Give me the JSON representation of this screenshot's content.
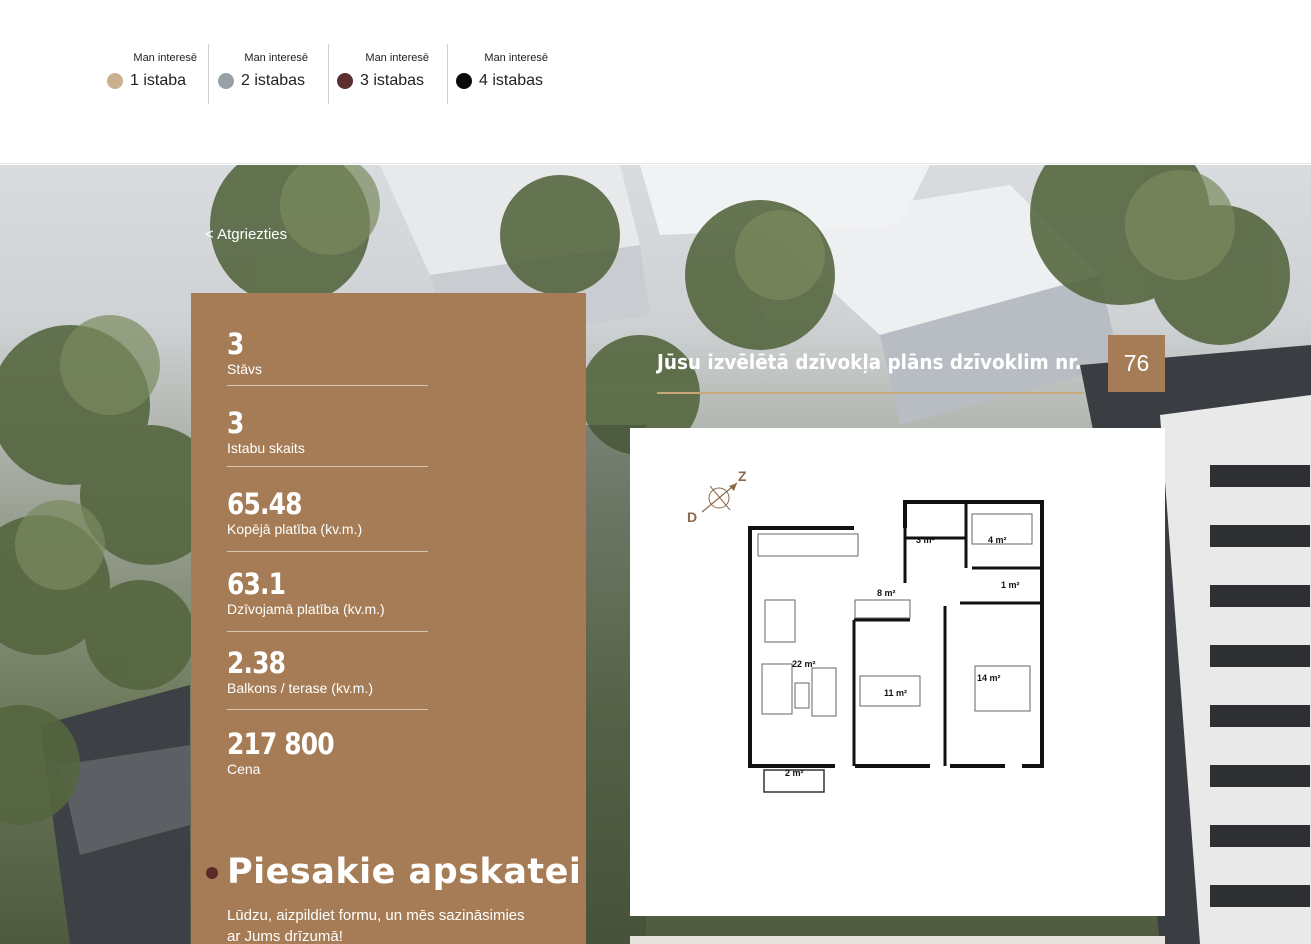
{
  "filters": {
    "caption": "Man interesē",
    "items": [
      {
        "label": "1 istaba",
        "color": "#cbb08f"
      },
      {
        "label": "2 istabas",
        "color": "#97a1a6"
      },
      {
        "label": "3 istabas",
        "color": "#5e2f31"
      },
      {
        "label": "4 istabas",
        "color": "#0a0a0a"
      }
    ]
  },
  "back_label": "< Atgriezties",
  "stats": [
    {
      "value": "3",
      "label": "Stāvs"
    },
    {
      "value": "3",
      "label": "Istabu skaits"
    },
    {
      "value": "65.48",
      "label": "Kopējā platība (kv.m.)"
    },
    {
      "value": "63.1",
      "label": "Dzīvojamā platība (kv.m.)"
    },
    {
      "value": "2.38",
      "label": "Balkons / terase (kv.m.)"
    },
    {
      "value": "217 800",
      "label": "Cena"
    }
  ],
  "apply": {
    "title": "Piesakie apskatei",
    "text": "Lūdzu, aizpildiet formu, un mēs sazināsimies ar Jums drīzumā!"
  },
  "plan": {
    "title": "Jūsu izvēlētā dzīvokļa plāns dzīvoklim nr.",
    "number": "76",
    "compass": {
      "north": "Z",
      "south": "D"
    },
    "rooms": [
      "3 m²",
      "4 m²",
      "1 m²",
      "8 m²",
      "22 m²",
      "11 m²",
      "14 m²",
      "2 m²"
    ]
  },
  "colors": {
    "accent": "#a57c55",
    "gold_line": "#c9a878"
  }
}
